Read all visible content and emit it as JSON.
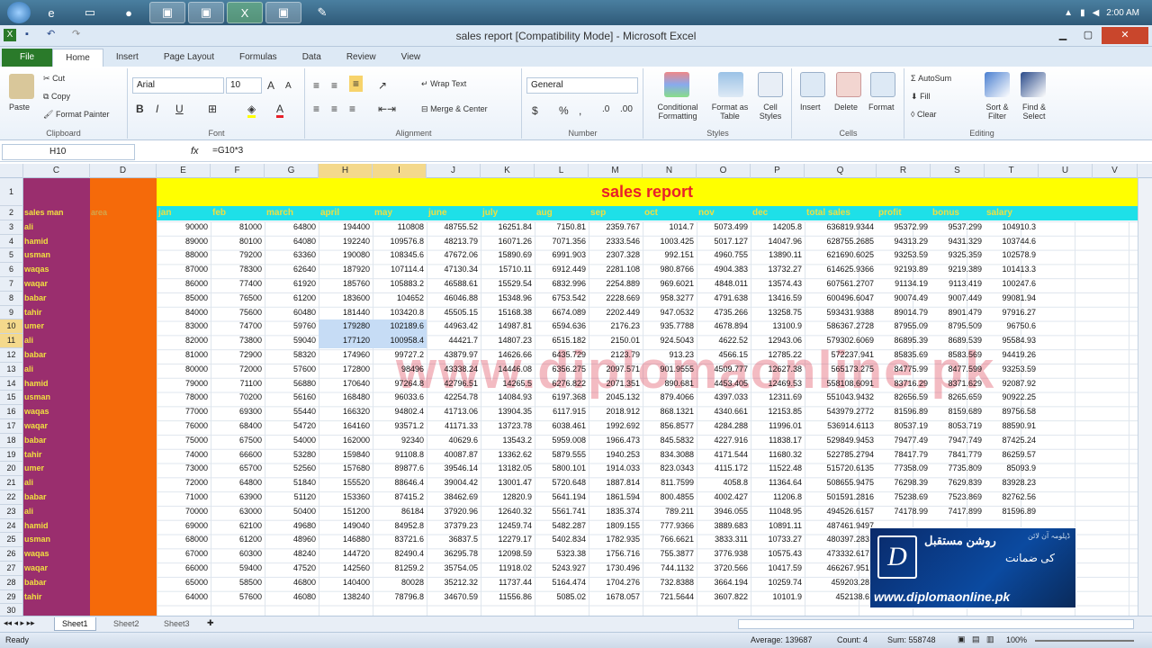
{
  "taskbar": {
    "clock": "2:00 AM"
  },
  "window": {
    "title": "sales report  [Compatibility Mode]  -  Microsoft Excel"
  },
  "ribbon_tabs": [
    "File",
    "Home",
    "Insert",
    "Page Layout",
    "Formulas",
    "Data",
    "Review",
    "View"
  ],
  "ribbon": {
    "clipboard": {
      "paste": "Paste",
      "cut": "Cut",
      "copy": "Copy",
      "format_painter": "Format Painter",
      "label": "Clipboard"
    },
    "font": {
      "name": "Arial",
      "size": "10",
      "label": "Font"
    },
    "alignment": {
      "wrap": "Wrap Text",
      "merge": "Merge & Center",
      "label": "Alignment"
    },
    "number": {
      "format": "General",
      "label": "Number"
    },
    "styles": {
      "conditional": "Conditional Formatting",
      "format_table": "Format as Table",
      "cell_styles": "Cell Styles",
      "label": "Styles"
    },
    "cells": {
      "insert": "Insert",
      "delete": "Delete",
      "format": "Format",
      "label": "Cells"
    },
    "editing": {
      "autosum": "AutoSum",
      "fill": "Fill",
      "clear": "Clear",
      "sort": "Sort & Filter",
      "find": "Find & Select",
      "label": "Editing"
    }
  },
  "formula_bar": {
    "name_box": "H10",
    "fx": "fx",
    "formula": "=G10*3"
  },
  "columns": [
    "C",
    "D",
    "E",
    "F",
    "G",
    "H",
    "I",
    "J",
    "K",
    "L",
    "M",
    "N",
    "O",
    "P",
    "Q",
    "R",
    "S",
    "T",
    "U",
    "V"
  ],
  "sheet": {
    "title": "sales report",
    "headers": [
      "sales man",
      "area",
      "jan",
      "feb",
      "march",
      "april",
      "may",
      "june",
      "july",
      "aug",
      "sep",
      "oct",
      "nov",
      "dec",
      "total sales",
      "profit",
      "bonus",
      "salary"
    ],
    "rows": [
      [
        "ali",
        "",
        90000,
        81000,
        64800,
        194400,
        110808,
        "48755.52",
        "16251.84",
        "7150.81",
        "2359.767",
        "1014.7",
        "5073.499",
        "14205.8",
        "636819.9344",
        "95372.99",
        "9537.299",
        "104910.3"
      ],
      [
        "hamid",
        "",
        89000,
        80100,
        64080,
        192240,
        "109576.8",
        "48213.79",
        "16071.26",
        "7071.356",
        "2333.546",
        "1003.425",
        "5017.127",
        "14047.96",
        "628755.2685",
        "94313.29",
        "9431.329",
        "103744.6"
      ],
      [
        "usman",
        "",
        88000,
        79200,
        63360,
        190080,
        "108345.6",
        "47672.06",
        "15890.69",
        "6991.903",
        "2307.328",
        "992.151",
        "4960.755",
        "13890.11",
        "621690.6025",
        "93253.59",
        "9325.359",
        "102578.9"
      ],
      [
        "waqas",
        "",
        87000,
        78300,
        62640,
        187920,
        "107114.4",
        "47130.34",
        "15710.11",
        "6912.449",
        "2281.108",
        "980.8766",
        "4904.383",
        "13732.27",
        "614625.9366",
        "92193.89",
        "9219.389",
        "101413.3"
      ],
      [
        "waqar",
        "",
        86000,
        77400,
        61920,
        185760,
        "105883.2",
        "46588.61",
        "15529.54",
        "6832.996",
        "2254.889",
        "969.6021",
        "4848.011",
        "13574.43",
        "607561.2707",
        "91134.19",
        "9113.419",
        "100247.6"
      ],
      [
        "babar",
        "",
        85000,
        76500,
        61200,
        183600,
        104652,
        "46046.88",
        "15348.96",
        "6753.542",
        "2228.669",
        "958.3277",
        "4791.638",
        "13416.59",
        "600496.6047",
        "90074.49",
        "9007.449",
        "99081.94"
      ],
      [
        "tahir",
        "",
        84000,
        75600,
        60480,
        181440,
        "103420.8",
        "45505.15",
        "15168.38",
        "6674.089",
        "2202.449",
        "947.0532",
        "4735.266",
        "13258.75",
        "593431.9388",
        "89014.79",
        "8901.479",
        "97916.27"
      ],
      [
        "umer",
        "",
        83000,
        74700,
        59760,
        179280,
        "102189.6",
        "44963.42",
        "14987.81",
        "6594.636",
        "2176.23",
        "935.7788",
        "4678.894",
        "13100.9",
        "586367.2728",
        "87955.09",
        "8795.509",
        "96750.6"
      ],
      [
        "ali",
        "",
        82000,
        73800,
        59040,
        177120,
        "100958.4",
        "44421.7",
        "14807.23",
        "6515.182",
        "2150.01",
        "924.5043",
        "4622.52",
        "12943.06",
        "579302.6069",
        "86895.39",
        "8689.539",
        "95584.93"
      ],
      [
        "babar",
        "",
        81000,
        72900,
        58320,
        174960,
        "99727.2",
        "43879.97",
        "14626.66",
        "6435.729",
        "2123.79",
        "913.23",
        "4566.15",
        "12785.22",
        "572237.941",
        "85835.69",
        "8583.569",
        "94419.26"
      ],
      [
        "ali",
        "",
        80000,
        72000,
        57600,
        172800,
        98496,
        "43338.24",
        "14446.08",
        "6356.275",
        "2097.571",
        "901.9555",
        "4509.777",
        "12627.38",
        "565173.275",
        "84775.99",
        "8477.599",
        "93253.59"
      ],
      [
        "hamid",
        "",
        79000,
        71100,
        56880,
        170640,
        "97264.8",
        "42796.51",
        "14265.5",
        "6276.822",
        "2071.351",
        "890.681",
        "4453.405",
        "12469.53",
        "558108.6091",
        "83716.29",
        "8371.629",
        "92087.92"
      ],
      [
        "usman",
        "",
        78000,
        70200,
        56160,
        168480,
        "96033.6",
        "42254.78",
        "14084.93",
        "6197.368",
        "2045.132",
        "879.4066",
        "4397.033",
        "12311.69",
        "551043.9432",
        "82656.59",
        "8265.659",
        "90922.25"
      ],
      [
        "waqas",
        "",
        77000,
        69300,
        55440,
        166320,
        "94802.4",
        "41713.06",
        "13904.35",
        "6117.915",
        "2018.912",
        "868.1321",
        "4340.661",
        "12153.85",
        "543979.2772",
        "81596.89",
        "8159.689",
        "89756.58"
      ],
      [
        "waqar",
        "",
        76000,
        68400,
        54720,
        164160,
        "93571.2",
        "41171.33",
        "13723.78",
        "6038.461",
        "1992.692",
        "856.8577",
        "4284.288",
        "11996.01",
        "536914.6113",
        "80537.19",
        "8053.719",
        "88590.91"
      ],
      [
        "babar",
        "",
        75000,
        67500,
        54000,
        162000,
        92340,
        "40629.6",
        "13543.2",
        "5959.008",
        "1966.473",
        "845.5832",
        "4227.916",
        "11838.17",
        "529849.9453",
        "79477.49",
        "7947.749",
        "87425.24"
      ],
      [
        "tahir",
        "",
        74000,
        66600,
        53280,
        159840,
        "91108.8",
        "40087.87",
        "13362.62",
        "5879.555",
        "1940.253",
        "834.3088",
        "4171.544",
        "11680.32",
        "522785.2794",
        "78417.79",
        "7841.779",
        "86259.57"
      ],
      [
        "umer",
        "",
        73000,
        65700,
        52560,
        157680,
        "89877.6",
        "39546.14",
        "13182.05",
        "5800.101",
        "1914.033",
        "823.0343",
        "4115.172",
        "11522.48",
        "515720.6135",
        "77358.09",
        "7735.809",
        "85093.9"
      ],
      [
        "ali",
        "",
        72000,
        64800,
        51840,
        155520,
        "88646.4",
        "39004.42",
        "13001.47",
        "5720.648",
        "1887.814",
        "811.7599",
        "4058.8",
        "11364.64",
        "508655.9475",
        "76298.39",
        "7629.839",
        "83928.23"
      ],
      [
        "babar",
        "",
        71000,
        63900,
        51120,
        153360,
        "87415.2",
        "38462.69",
        "12820.9",
        "5641.194",
        "1861.594",
        "800.4855",
        "4002.427",
        "11206.8",
        "501591.2816",
        "75238.69",
        "7523.869",
        "82762.56"
      ],
      [
        "ali",
        "",
        70000,
        63000,
        50400,
        151200,
        86184,
        "37920.96",
        "12640.32",
        "5561.741",
        "1835.374",
        "789.211",
        "3946.055",
        "11048.95",
        "494526.6157",
        "74178.99",
        "7417.899",
        "81596.89"
      ],
      [
        "hamid",
        "",
        69000,
        62100,
        49680,
        149040,
        "84952.8",
        "37379.23",
        "12459.74",
        "5482.287",
        "1809.155",
        "777.9366",
        "3889.683",
        "10891.11",
        "487461.9497",
        "",
        "",
        ""
      ],
      [
        "usman",
        "",
        68000,
        61200,
        48960,
        146880,
        "83721.6",
        "36837.5",
        "12279.17",
        "5402.834",
        "1782.935",
        "766.6621",
        "3833.311",
        "10733.27",
        "480397.2838",
        "",
        "",
        ""
      ],
      [
        "waqas",
        "",
        67000,
        60300,
        48240,
        144720,
        "82490.4",
        "36295.78",
        "12098.59",
        "5323.38",
        "1756.716",
        "755.3877",
        "3776.938",
        "10575.43",
        "473332.6178",
        "",
        "",
        ""
      ],
      [
        "waqar",
        "",
        66000,
        59400,
        47520,
        142560,
        "81259.2",
        "35754.05",
        "11918.02",
        "5243.927",
        "1730.496",
        "744.1132",
        "3720.566",
        "10417.59",
        "466267.9519",
        "",
        "",
        ""
      ],
      [
        "babar",
        "",
        65000,
        58500,
        46800,
        140400,
        80028,
        "35212.32",
        "11737.44",
        "5164.474",
        "1704.276",
        "732.8388",
        "3664.194",
        "10259.74",
        "459203.286",
        "",
        "",
        ""
      ],
      [
        "tahir",
        "",
        64000,
        57600,
        46080,
        138240,
        "78796.8",
        "34670.59",
        "11556.86",
        "5085.02",
        "1678.057",
        "721.5644",
        "3607.822",
        "10101.9",
        "452138.62",
        "",
        "",
        ""
      ]
    ]
  },
  "watermark": "www.diplomaonline.pk",
  "sheet_tabs": [
    "Sheet1",
    "Sheet2",
    "Sheet3"
  ],
  "status": {
    "ready": "Ready",
    "average": "Average: 139687",
    "count": "Count: 4",
    "sum": "Sum: 558748",
    "zoom": "100%"
  },
  "logo": {
    "letter": "D",
    "urdu1": "روشن مستقبل",
    "urdu2": "کی ضمانت",
    "small": "ڈپلومہ آن لائن",
    "url": "www.diplomaonline.pk"
  }
}
